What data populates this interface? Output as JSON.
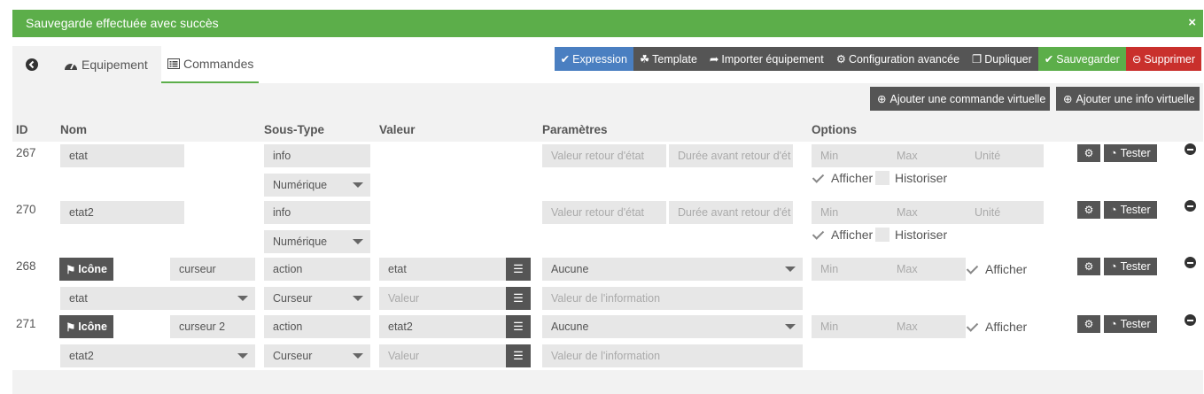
{
  "alert": {
    "message": "Sauvegarde effectuée avec succès",
    "close": "×"
  },
  "tabs": {
    "equipement": "Equipement",
    "commandes": "Commandes"
  },
  "toolbar": {
    "expression": "Expression",
    "template": "Template",
    "importer": "Importer équipement",
    "config": "Configuration avancée",
    "dupliquer": "Dupliquer",
    "sauvegarder": "Sauvegarder",
    "supprimer": "Supprimer"
  },
  "colors": {
    "expression": "#4a7fc1",
    "dark": "#555555",
    "save": "#5cae4a",
    "delete": "#c9302c"
  },
  "add": {
    "virtual_cmd": "Ajouter une commande virtuelle",
    "virtual_info": "Ajouter une info virtuelle"
  },
  "headers": {
    "id": "ID",
    "nom": "Nom",
    "soustype": "Sous-Type",
    "valeur": "Valeur",
    "parametres": "Paramètres",
    "options": "Options"
  },
  "common": {
    "valeur_retour": "Valeur retour d'état",
    "duree_retour": "Durée avant retour d'ét",
    "min": "Min",
    "max": "Max",
    "unite": "Unité",
    "afficher": "Afficher",
    "historiser": "Historiser",
    "tester": "Tester",
    "icone": "Icône",
    "valeur_ph": "Valeur",
    "valeur_info_ph": "Valeur de l'information"
  },
  "rows": [
    {
      "id": "267",
      "name": "etat",
      "type": "info",
      "subtype": "Numérique"
    },
    {
      "id": "270",
      "name": "etat2",
      "type": "info",
      "subtype": "Numérique"
    },
    {
      "id": "268",
      "name": "curseur",
      "type": "action",
      "value": "etat",
      "param": "Aucune",
      "link": "etat",
      "subtype": "Curseur"
    },
    {
      "id": "271",
      "name": "curseur 2",
      "type": "action",
      "value": "etat2",
      "param": "Aucune",
      "link": "etat2",
      "subtype": "Curseur"
    }
  ]
}
